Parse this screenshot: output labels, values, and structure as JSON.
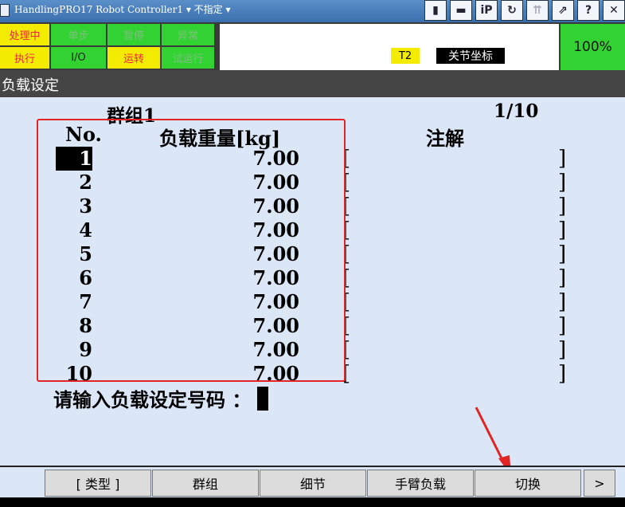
{
  "titlebar": {
    "title": "HandlingPRO17  Robot Controller1 ▾ 不指定 ▾",
    "icons": [
      "trash-icon",
      "keyboard-icon",
      "ip-icon",
      "refresh-icon",
      "tree-icon",
      "export-icon",
      "help-icon",
      "close-icon"
    ]
  },
  "status": {
    "indicators_top": [
      {
        "label": "处理中",
        "color": "yellow",
        "on": false
      },
      {
        "label": "单步",
        "color": "green",
        "on": false
      },
      {
        "label": "暂停",
        "color": "green",
        "on": false
      },
      {
        "label": "异常",
        "color": "green",
        "on": false
      }
    ],
    "indicators_bottom": [
      {
        "label": "执行",
        "color": "yellow",
        "on": false
      },
      {
        "label": "I/O",
        "color": "green",
        "on": true
      },
      {
        "label": "运转",
        "color": "yellow",
        "on": false
      },
      {
        "label": "试运行",
        "color": "green",
        "on": false
      }
    ],
    "mode": "T2",
    "coord": "关节坐标",
    "speed": "100%"
  },
  "screen": {
    "title": "负载设定",
    "group": "群组1",
    "page": "1/10",
    "headers": {
      "no": "No.",
      "weight": "负载重量[kg]",
      "comment": "注解"
    },
    "rows": [
      {
        "no": "1",
        "weight": "7.00",
        "comment": ""
      },
      {
        "no": "2",
        "weight": "7.00",
        "comment": ""
      },
      {
        "no": "3",
        "weight": "7.00",
        "comment": ""
      },
      {
        "no": "4",
        "weight": "7.00",
        "comment": ""
      },
      {
        "no": "5",
        "weight": "7.00",
        "comment": ""
      },
      {
        "no": "6",
        "weight": "7.00",
        "comment": ""
      },
      {
        "no": "7",
        "weight": "7.00",
        "comment": ""
      },
      {
        "no": "8",
        "weight": "7.00",
        "comment": ""
      },
      {
        "no": "9",
        "weight": "7.00",
        "comment": ""
      },
      {
        "no": "10",
        "weight": "7.00",
        "comment": ""
      }
    ],
    "selected_index": 0,
    "prompt": "请输入负载设定号码 ："
  },
  "fkeys": [
    {
      "label": "[ 类型 ]"
    },
    {
      "label": "群组"
    },
    {
      "label": "细节"
    },
    {
      "label": "手臂负载"
    },
    {
      "label": "切换"
    }
  ],
  "next_label": ">",
  "colors": {
    "accent_yellow": "#f4ec00",
    "accent_green": "#33d233",
    "annotation_red": "#e32424",
    "screen_bg": "#dbe6f6"
  }
}
